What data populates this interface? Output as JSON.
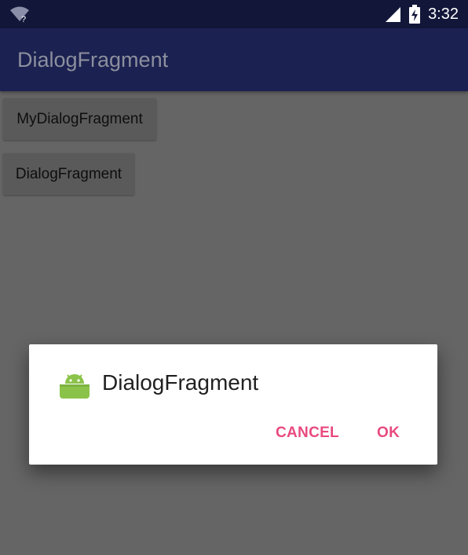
{
  "status_bar": {
    "wifi_badge": "?",
    "time": "3:32",
    "icons": [
      "wifi-unknown-icon",
      "signal-icon",
      "battery-charging-icon"
    ]
  },
  "app_bar": {
    "title": "DialogFragment"
  },
  "buttons": [
    {
      "label": "MyDialogFragment"
    },
    {
      "label": "DialogFragment"
    }
  ],
  "dialog": {
    "icon": "android-icon",
    "title": "DialogFragment",
    "cancel_label": "CANCEL",
    "ok_label": "OK",
    "accent_color": "#e84a7f"
  }
}
